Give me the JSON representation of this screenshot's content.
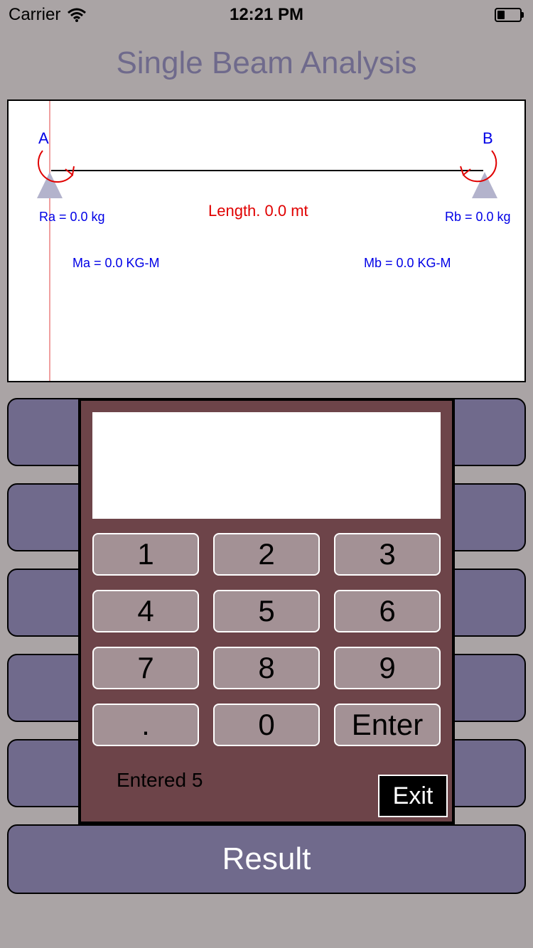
{
  "status": {
    "carrier": "Carrier",
    "time": "12:21 PM"
  },
  "title": "Single Beam Analysis",
  "diagram": {
    "node_a": "A",
    "node_b": "B",
    "ra": "Ra = 0.0 kg",
    "rb": "Rb = 0.0 kg",
    "length": "Length. 0.0 mt",
    "ma": "Ma = 0.0 KG-M",
    "mb": "Mb = 0.0 KG-M"
  },
  "keypad": {
    "display_value": "",
    "keys": [
      "1",
      "2",
      "3",
      "4",
      "5",
      "6",
      "7",
      "8",
      "9",
      ".",
      "0",
      "Enter"
    ],
    "entered": "Entered 5",
    "exit": "Exit"
  },
  "result_label": "Result",
  "colors": {
    "background": "#aaa4a5",
    "accent_purple": "#706a8c",
    "keypad_bg": "#6d4449",
    "key_bg": "#a39195",
    "label_blue": "#0000e6",
    "label_red": "#e00000"
  }
}
